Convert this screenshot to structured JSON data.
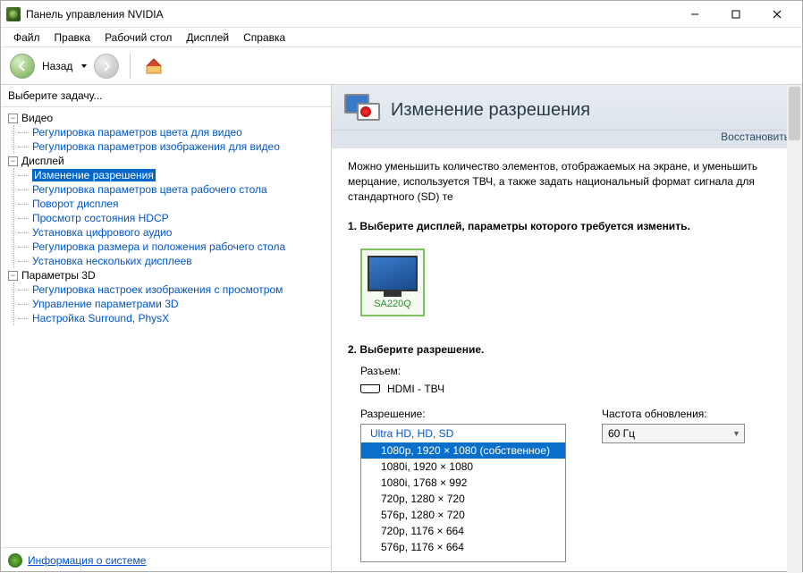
{
  "window": {
    "title": "Панель управления NVIDIA"
  },
  "menu": {
    "file": "Файл",
    "edit": "Правка",
    "desktop": "Рабочий стол",
    "display": "Дисплей",
    "help": "Справка"
  },
  "toolbar": {
    "back_label": "Назад"
  },
  "sidebar": {
    "title": "Выберите задачу...",
    "groups": [
      {
        "label": "Видео",
        "items": [
          "Регулировка параметров цвета для видео",
          "Регулировка параметров изображения для видео"
        ]
      },
      {
        "label": "Дисплей",
        "items": [
          "Изменение разрешения",
          "Регулировка параметров цвета рабочего стола",
          "Поворот дисплея",
          "Просмотр состояния HDCP",
          "Установка цифрового аудио",
          "Регулировка размера и положения рабочего стола",
          "Установка нескольких дисплеев"
        ],
        "selected": 0
      },
      {
        "label": "Параметры 3D",
        "items": [
          "Регулировка настроек изображения с просмотром",
          "Управление параметрами 3D",
          "Настройка Surround, PhysX"
        ]
      }
    ],
    "system_info": "Информация о системе"
  },
  "page": {
    "title": "Изменение разрешения",
    "restore": "Восстановить",
    "description": "Можно уменьшить количество элементов, отображаемых на экране, и уменьшить мерцание, используется ТВЧ, а также задать национальный формат сигнала для стандартного (SD) те",
    "step1_title": "1. Выберите дисплей, параметры которого требуется изменить.",
    "display_name": "SA220Q",
    "step2_title": "2. Выберите разрешение.",
    "connector_label": "Разъем:",
    "connector_value": "HDMI - ТВЧ",
    "resolution_label": "Разрешение:",
    "refresh_label": "Частота обновления:",
    "refresh_value": "60 Гц",
    "resolutions": {
      "group": "Ultra HD, HD, SD",
      "items": [
        "1080p, 1920 × 1080 (собственное)",
        "1080i, 1920 × 1080",
        "1080i, 1768 × 992",
        "720p, 1280 × 720",
        "576p, 1280 × 720",
        "720p, 1176 × 664",
        "576p, 1176 × 664"
      ],
      "selected": 0
    }
  }
}
